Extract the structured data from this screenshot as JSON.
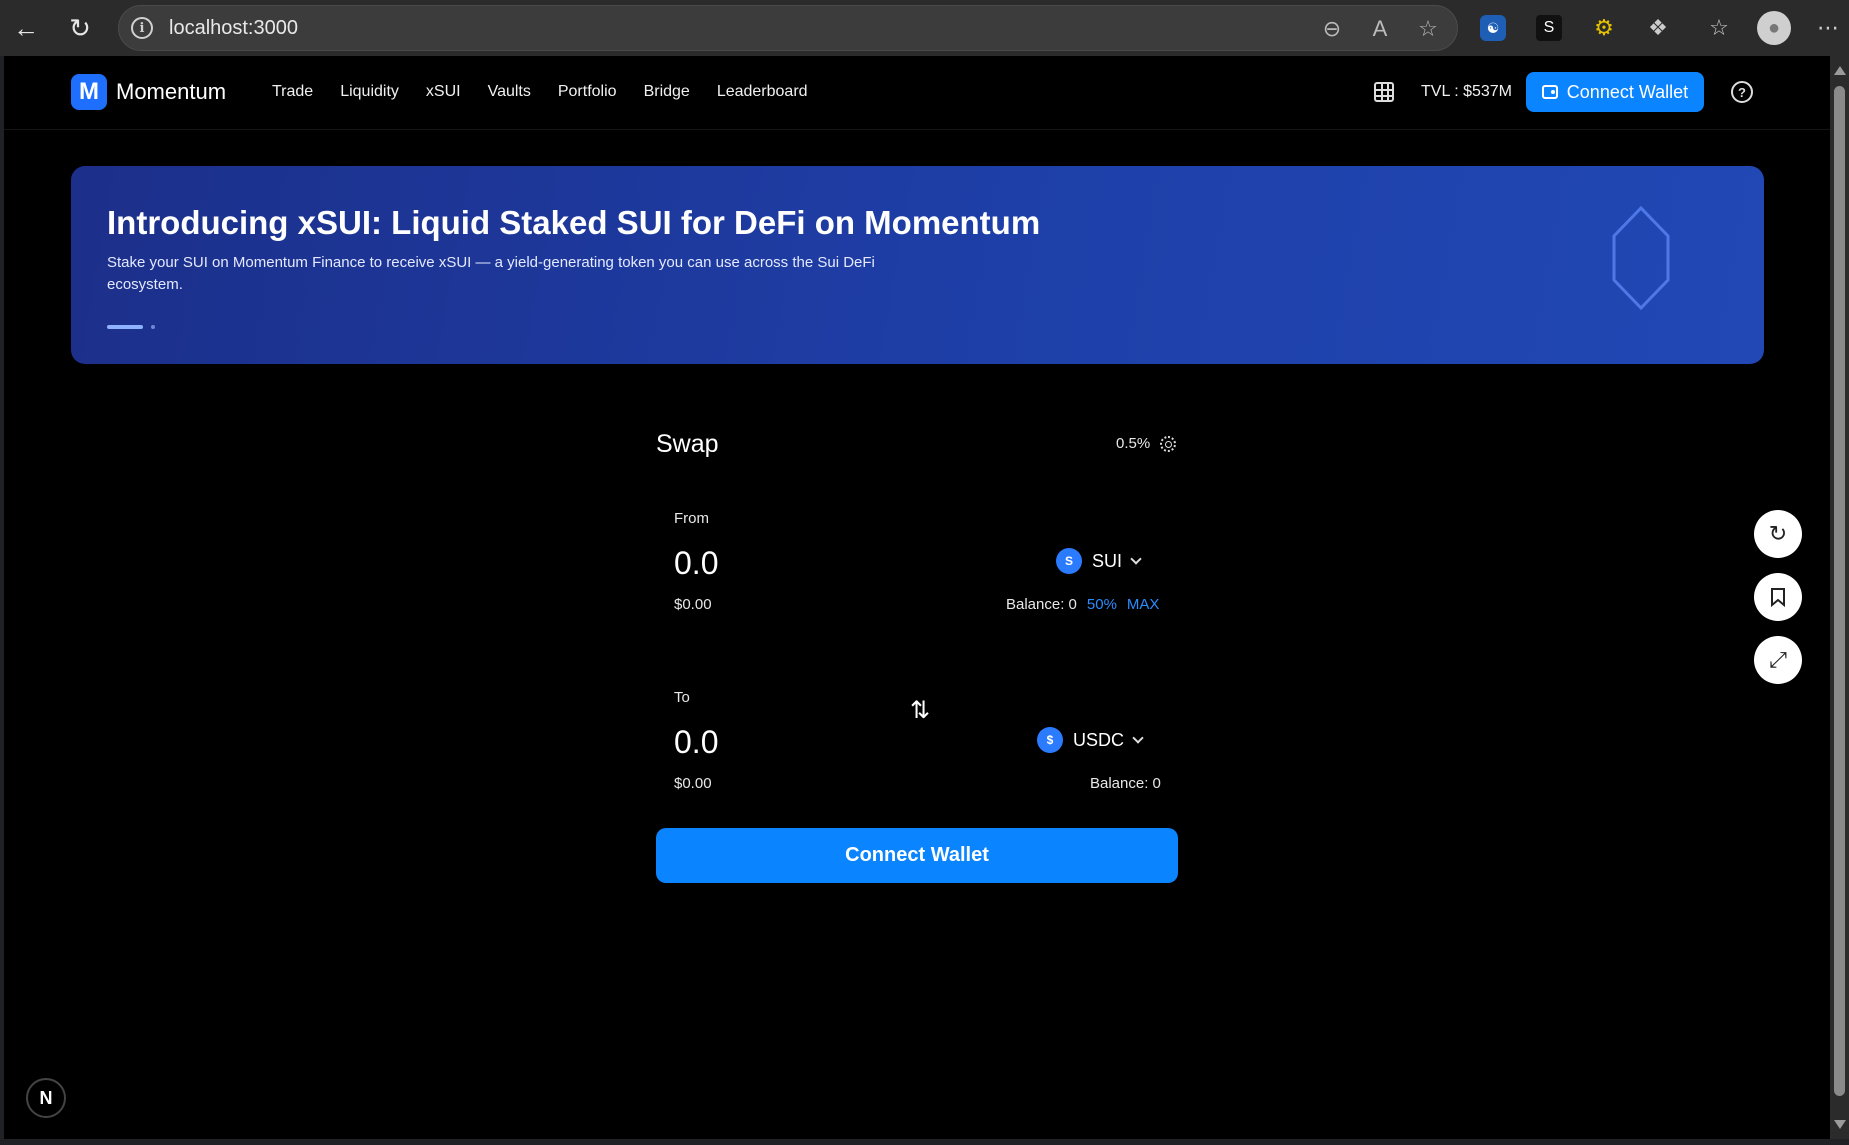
{
  "browser": {
    "url": "localhost:3000",
    "icons": [
      "back-icon",
      "reload-icon",
      "info-icon",
      "zoom-out-icon",
      "read-aloud-icon",
      "favorite-star-icon",
      "extension-1-icon",
      "extension-2-icon",
      "extension-3-icon",
      "extensions-icon",
      "favorites-icon",
      "profile-icon",
      "more-icon"
    ]
  },
  "header": {
    "logo_letter": "M",
    "brand": "Momentum",
    "nav": [
      "Trade",
      "Liquidity",
      "xSUI",
      "Vaults",
      "Portfolio",
      "Bridge",
      "Leaderboard"
    ],
    "tvl": "TVL : $537M",
    "connect_label": "Connect Wallet",
    "help_symbol": "?"
  },
  "banner": {
    "title": "Introducing xSUI: Liquid Staked SUI for DeFi on Momentum",
    "description": "Stake your SUI on Momentum Finance to receive xSUI — a yield-generating token you can use across the Sui DeFi ecosystem."
  },
  "swap": {
    "title": "Swap",
    "slippage": "0.5%",
    "from": {
      "label": "From",
      "amount": "0.0",
      "usd": "$0.00",
      "token": "SUI",
      "token_letter": "S",
      "balance": "Balance: 0",
      "pct_label": "50%",
      "max_label": "MAX"
    },
    "to": {
      "label": "To",
      "amount": "0.0",
      "usd": "$0.00",
      "token": "USDC",
      "token_letter": "$",
      "balance": "Balance: 0"
    },
    "connect_label": "Connect Wallet"
  },
  "colors": {
    "accent": "#0a84ff",
    "banner": "#1e3fa8",
    "background": "#000000"
  },
  "floating": [
    "refresh-icon",
    "bookmark-icon",
    "expand-icon"
  ],
  "dev_badge": "N"
}
